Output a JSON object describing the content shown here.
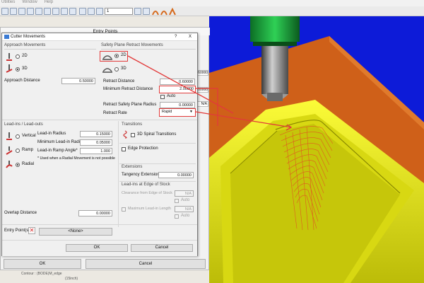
{
  "menu": [
    "Utilities",
    "Window",
    "Help"
  ],
  "toolbar": {
    "combo_value": "1"
  },
  "outer_dialog": {
    "title": "Entry Points",
    "ok_label": "OK",
    "cancel_label": "Cancel",
    "partial_values": [
      "0.60000",
      "2.00000",
      "N/A"
    ]
  },
  "status": {
    "line1": "Contour : (BODE)M_edge",
    "line2": "(15inch)"
  },
  "dialog": {
    "title": "Cutter Movements",
    "help": "?",
    "close": "X",
    "approach": {
      "title": "Approach Movements",
      "opt_2d": "2D",
      "opt_3d": "3D",
      "selected": "3D",
      "distance_label": "Approach Distance",
      "distance_value": "0.50000"
    },
    "safety": {
      "title": "Safety Plane Retract Movements",
      "opt_2d": "2D",
      "opt_3d": "3D",
      "selected": "2D",
      "retract_distance_label": "Retract Distance",
      "retract_distance_value": "0.60000",
      "min_retract_label": "Minimum Retract Distance",
      "min_retract_value": "2.00000",
      "auto_label": "Auto",
      "radius_label": "Retract Safety Plane Radius",
      "radius_value": "0.00000",
      "rate_label": "Retract Rate",
      "rate_value": "Rapid"
    },
    "leadin": {
      "title": "Lead-ins / Lead-outs",
      "opt_vertical": "Vertical",
      "opt_ramp": "Ramp",
      "opt_radial": "Radial",
      "selected": "Radial",
      "radius_label": "Lead-in Radius",
      "radius_value": "0.15000",
      "min_radius_label": "Minimum Lead-in Radius",
      "min_radius_value": "0.05000",
      "ramp_angle_label": "Lead-in Ramp Angle*",
      "ramp_angle_value": "1.000",
      "note": "* Used when a Radial Movement is not possible",
      "overlap_label": "Overlap Distance",
      "overlap_value": "0.00000"
    },
    "transitions": {
      "title": "Transitions",
      "spiral_label": "3D Spiral Transitions",
      "edge_label": "Edge Protection"
    },
    "extensions": {
      "title": "Extensions",
      "tangency_label": "Tangency Extension",
      "tangency_value": "0.00000"
    },
    "edge_stock": {
      "title": "Lead-ins at Edge of Stock",
      "clearance_label": "Clearance from Edge of Stock",
      "clearance_value": "N/A",
      "auto_label": "Auto",
      "max_len_label": "Maximum Lead-in Length",
      "max_len_value": "N/A",
      "auto2_label": "Auto"
    },
    "entry_points": {
      "label": "Entry Point(s)",
      "button": "<None>"
    },
    "ok_label": "OK",
    "cancel_label": "Cancel"
  },
  "colors": {
    "viewport_bg": "#0d1bd8",
    "stock_orange": "#d4661e",
    "part_yellow": "#e8e810",
    "spindle_green": "#1aa83a",
    "highlight": "#e23a3a",
    "toolpath": "#e05a20"
  }
}
